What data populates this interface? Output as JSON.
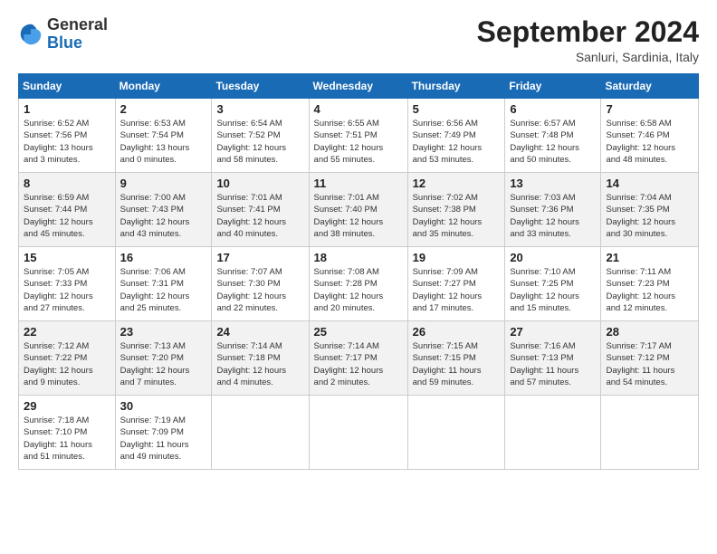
{
  "header": {
    "logo": {
      "general": "General",
      "blue": "Blue"
    },
    "title": "September 2024",
    "subtitle": "Sanluri, Sardinia, Italy"
  },
  "calendar": {
    "weekdays": [
      "Sunday",
      "Monday",
      "Tuesday",
      "Wednesday",
      "Thursday",
      "Friday",
      "Saturday"
    ],
    "weeks": [
      [
        {
          "day": "1",
          "info": "Sunrise: 6:52 AM\nSunset: 7:56 PM\nDaylight: 13 hours\nand 3 minutes."
        },
        {
          "day": "2",
          "info": "Sunrise: 6:53 AM\nSunset: 7:54 PM\nDaylight: 13 hours\nand 0 minutes."
        },
        {
          "day": "3",
          "info": "Sunrise: 6:54 AM\nSunset: 7:52 PM\nDaylight: 12 hours\nand 58 minutes."
        },
        {
          "day": "4",
          "info": "Sunrise: 6:55 AM\nSunset: 7:51 PM\nDaylight: 12 hours\nand 55 minutes."
        },
        {
          "day": "5",
          "info": "Sunrise: 6:56 AM\nSunset: 7:49 PM\nDaylight: 12 hours\nand 53 minutes."
        },
        {
          "day": "6",
          "info": "Sunrise: 6:57 AM\nSunset: 7:48 PM\nDaylight: 12 hours\nand 50 minutes."
        },
        {
          "day": "7",
          "info": "Sunrise: 6:58 AM\nSunset: 7:46 PM\nDaylight: 12 hours\nand 48 minutes."
        }
      ],
      [
        {
          "day": "8",
          "info": "Sunrise: 6:59 AM\nSunset: 7:44 PM\nDaylight: 12 hours\nand 45 minutes."
        },
        {
          "day": "9",
          "info": "Sunrise: 7:00 AM\nSunset: 7:43 PM\nDaylight: 12 hours\nand 43 minutes."
        },
        {
          "day": "10",
          "info": "Sunrise: 7:01 AM\nSunset: 7:41 PM\nDaylight: 12 hours\nand 40 minutes."
        },
        {
          "day": "11",
          "info": "Sunrise: 7:01 AM\nSunset: 7:40 PM\nDaylight: 12 hours\nand 38 minutes."
        },
        {
          "day": "12",
          "info": "Sunrise: 7:02 AM\nSunset: 7:38 PM\nDaylight: 12 hours\nand 35 minutes."
        },
        {
          "day": "13",
          "info": "Sunrise: 7:03 AM\nSunset: 7:36 PM\nDaylight: 12 hours\nand 33 minutes."
        },
        {
          "day": "14",
          "info": "Sunrise: 7:04 AM\nSunset: 7:35 PM\nDaylight: 12 hours\nand 30 minutes."
        }
      ],
      [
        {
          "day": "15",
          "info": "Sunrise: 7:05 AM\nSunset: 7:33 PM\nDaylight: 12 hours\nand 27 minutes."
        },
        {
          "day": "16",
          "info": "Sunrise: 7:06 AM\nSunset: 7:31 PM\nDaylight: 12 hours\nand 25 minutes."
        },
        {
          "day": "17",
          "info": "Sunrise: 7:07 AM\nSunset: 7:30 PM\nDaylight: 12 hours\nand 22 minutes."
        },
        {
          "day": "18",
          "info": "Sunrise: 7:08 AM\nSunset: 7:28 PM\nDaylight: 12 hours\nand 20 minutes."
        },
        {
          "day": "19",
          "info": "Sunrise: 7:09 AM\nSunset: 7:27 PM\nDaylight: 12 hours\nand 17 minutes."
        },
        {
          "day": "20",
          "info": "Sunrise: 7:10 AM\nSunset: 7:25 PM\nDaylight: 12 hours\nand 15 minutes."
        },
        {
          "day": "21",
          "info": "Sunrise: 7:11 AM\nSunset: 7:23 PM\nDaylight: 12 hours\nand 12 minutes."
        }
      ],
      [
        {
          "day": "22",
          "info": "Sunrise: 7:12 AM\nSunset: 7:22 PM\nDaylight: 12 hours\nand 9 minutes."
        },
        {
          "day": "23",
          "info": "Sunrise: 7:13 AM\nSunset: 7:20 PM\nDaylight: 12 hours\nand 7 minutes."
        },
        {
          "day": "24",
          "info": "Sunrise: 7:14 AM\nSunset: 7:18 PM\nDaylight: 12 hours\nand 4 minutes."
        },
        {
          "day": "25",
          "info": "Sunrise: 7:14 AM\nSunset: 7:17 PM\nDaylight: 12 hours\nand 2 minutes."
        },
        {
          "day": "26",
          "info": "Sunrise: 7:15 AM\nSunset: 7:15 PM\nDaylight: 11 hours\nand 59 minutes."
        },
        {
          "day": "27",
          "info": "Sunrise: 7:16 AM\nSunset: 7:13 PM\nDaylight: 11 hours\nand 57 minutes."
        },
        {
          "day": "28",
          "info": "Sunrise: 7:17 AM\nSunset: 7:12 PM\nDaylight: 11 hours\nand 54 minutes."
        }
      ],
      [
        {
          "day": "29",
          "info": "Sunrise: 7:18 AM\nSunset: 7:10 PM\nDaylight: 11 hours\nand 51 minutes."
        },
        {
          "day": "30",
          "info": "Sunrise: 7:19 AM\nSunset: 7:09 PM\nDaylight: 11 hours\nand 49 minutes."
        },
        null,
        null,
        null,
        null,
        null
      ]
    ]
  }
}
